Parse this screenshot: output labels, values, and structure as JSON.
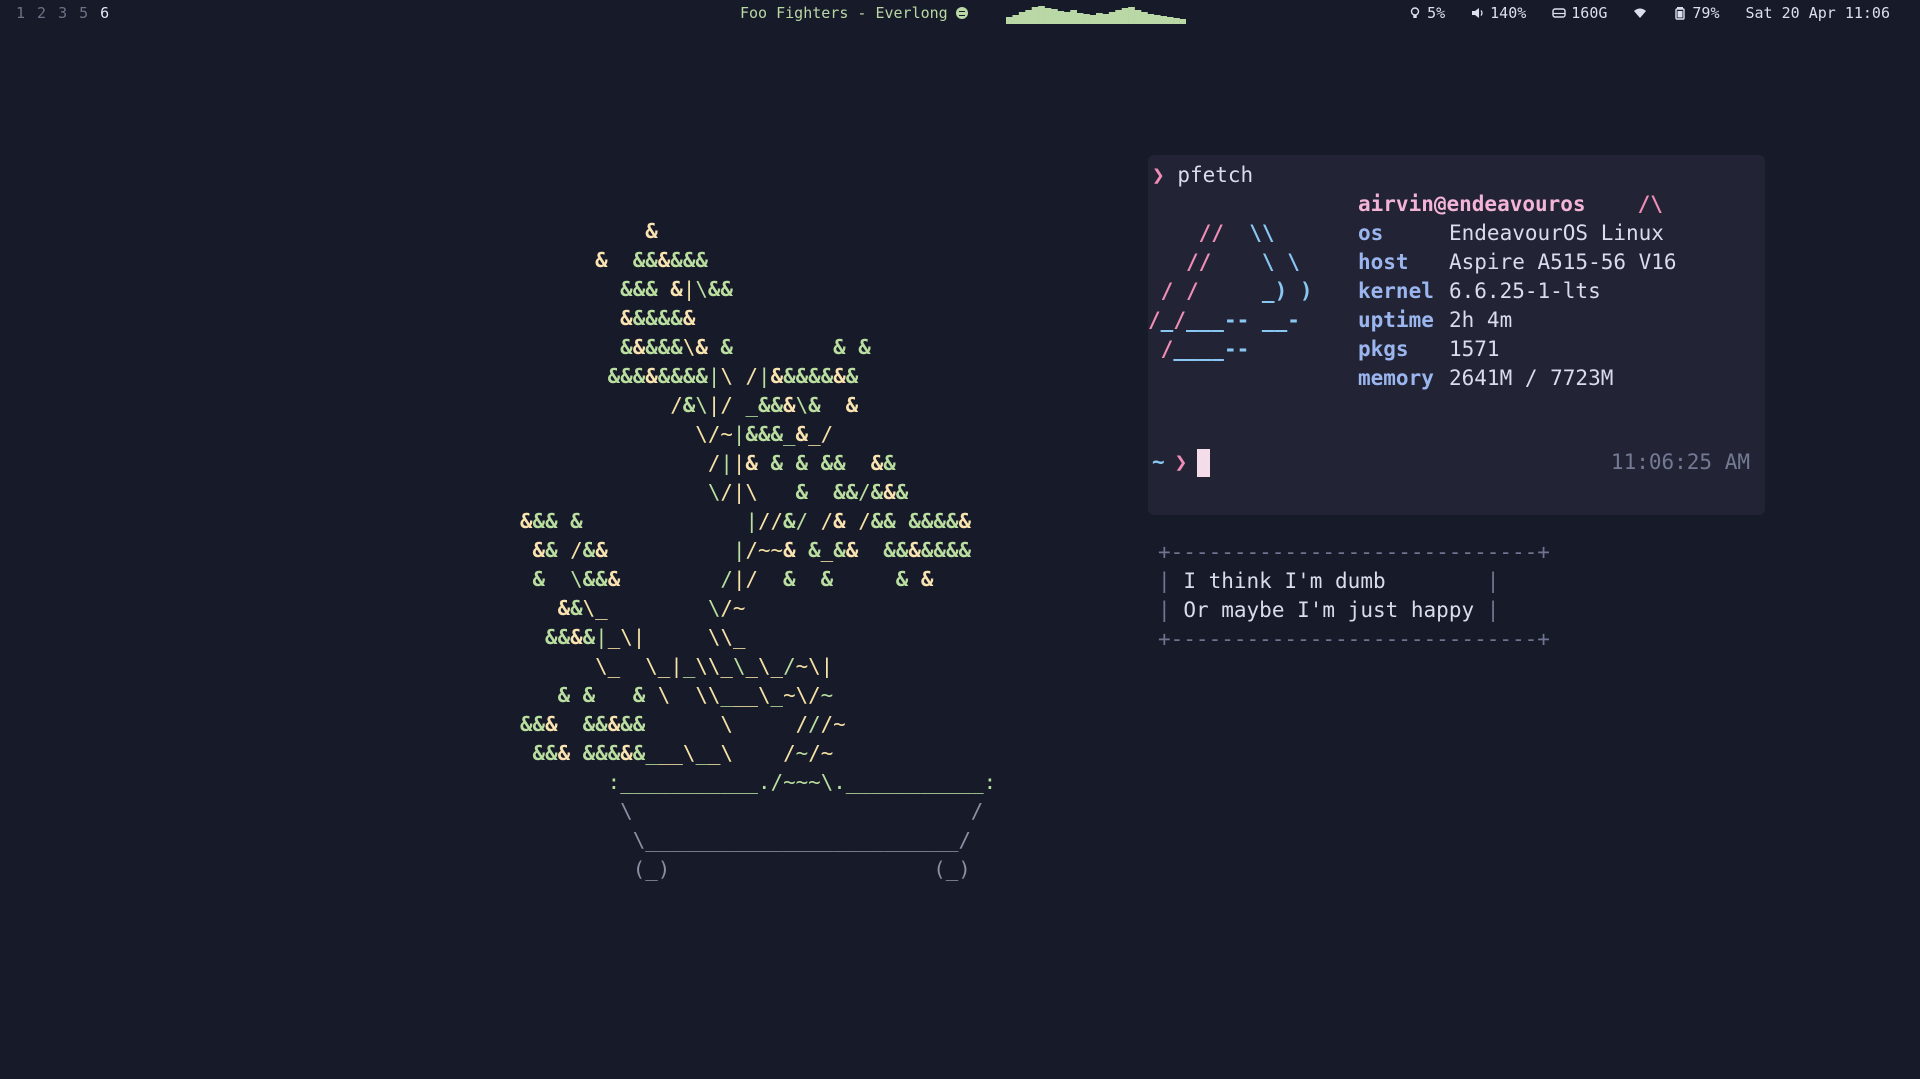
{
  "bar": {
    "workspaces": [
      {
        "label": "1",
        "active": false
      },
      {
        "label": "2",
        "active": false
      },
      {
        "label": "3",
        "active": false
      },
      {
        "label": "5",
        "active": false
      },
      {
        "label": "6",
        "active": true
      }
    ],
    "media": {
      "text": "Foo Fighters - Everlong",
      "icon": "spotify-icon"
    },
    "visualizer_levels": [
      0.35,
      0.45,
      0.6,
      0.7,
      0.85,
      0.9,
      0.8,
      0.75,
      0.65,
      0.6,
      0.7,
      0.55,
      0.5,
      0.45,
      0.55,
      0.5,
      0.6,
      0.7,
      0.8,
      0.85,
      0.7,
      0.6,
      0.5,
      0.45,
      0.4,
      0.35,
      0.3,
      0.25
    ],
    "status": {
      "brightness": "5%",
      "volume": "140%",
      "disk": "160G",
      "battery": "79%",
      "datetime": "Sat 20 Apr 11:06"
    },
    "colors": {
      "accent": "#b9d8a6",
      "text": "#dcdff0",
      "inactive": "#6d7289"
    }
  },
  "bonsai": {
    "lines": [
      "          &",
      "      &  &&&&&&",
      "        &&& &|\\&&",
      "        &&&&&&",
      "        &&&&&\\& &        & &",
      "       &&&&&&&&|\\ /|&&&&&&&",
      "            /&\\|/ _&&&\\&  &",
      "              \\/~|&&&_&_/",
      "               /||& & & &&  &&",
      "               \\/|\\   &  &&/&&&",
      "&&& &             |//&/ /& /&& &&&&&",
      " && /&&          |/~~& &_&&  &&&&&&&",
      " &  \\&&&        /|/  &  &     & &",
      "   &&\\_        \\/~",
      "  &&&&|_\\|     \\\\_",
      "      \\_  \\_|_\\\\_\\_\\_/~\\|",
      "   & &   & \\  \\\\___\\_~\\/~",
      "&&&  &&&&&      \\     ///~",
      " &&& &&&&&___\\__\\    /~/~",
      "       :___________./~~~\\.___________:",
      "        \\                           /",
      "         \\_________________________/",
      "         (_)                     (_)"
    ]
  },
  "terminal": {
    "prompt_symbol": "❯",
    "command": "pfetch",
    "logo_lines": [
      "    //  \\\\",
      "   //    \\ \\",
      " / /     _) )",
      "/_/___-- __-",
      " /____--"
    ],
    "user": "airvin@endeavouros",
    "user_logo": "/\\",
    "info": [
      {
        "key": "os",
        "value": "EndeavourOS Linux"
      },
      {
        "key": "host",
        "value": "Aspire A515-56 V16"
      },
      {
        "key": "kernel",
        "value": "6.6.25-1-lts"
      },
      {
        "key": "uptime",
        "value": "2h 4m"
      },
      {
        "key": "pkgs",
        "value": "1571"
      },
      {
        "key": "memory",
        "value": "2641M / 7723M"
      }
    ],
    "cwd": "~",
    "time": "11:06:25 AM"
  },
  "fortune": {
    "top": "+-----------------------------+",
    "lines": [
      "I think I'm dumb",
      "Or maybe I'm just happy"
    ],
    "bottom": "+-----------------------------+"
  }
}
